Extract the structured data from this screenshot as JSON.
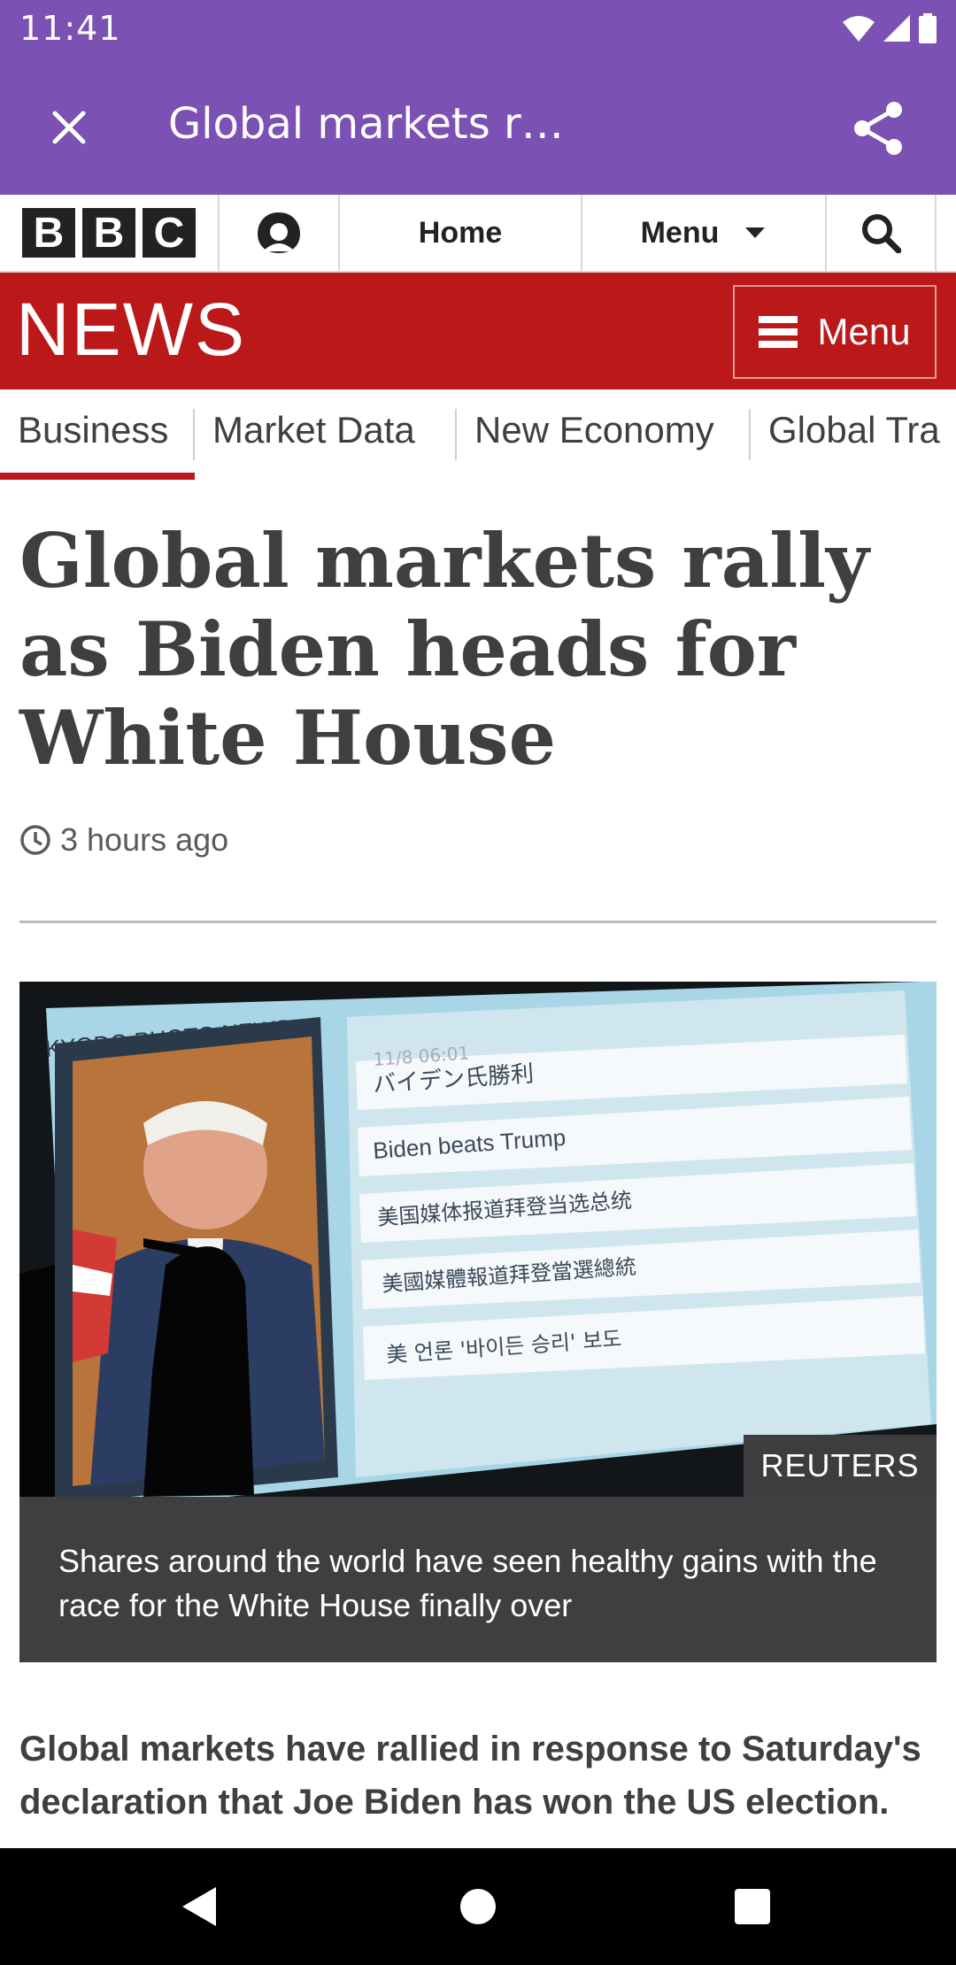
{
  "status_bar": {
    "time": "11:41",
    "icons": [
      "wifi-icon",
      "signal-icon",
      "battery-icon"
    ]
  },
  "app_bar": {
    "title": "Global markets r…",
    "close_icon": "close-icon",
    "share_icon": "share-icon"
  },
  "bbc_nav": {
    "logo_letters": [
      "B",
      "B",
      "C"
    ],
    "account_icon": "account-icon",
    "home_label": "Home",
    "menu_label": "Menu",
    "search_icon": "search-icon"
  },
  "news_banner": {
    "logo": "NEWS",
    "menu_label": "Menu"
  },
  "section_nav": {
    "items": [
      "Business",
      "Market Data",
      "New Economy",
      "Global Tra"
    ],
    "active": "Business"
  },
  "article": {
    "headline": "Global markets rally as Biden heads for White House",
    "timestamp": "3 hours ago",
    "image": {
      "screen_header": "KYODO PHOTO NEWS",
      "screen_time": "11/8 06:01",
      "screen_lines": [
        "バイデン氏勝利",
        "Biden beats Trump",
        "美国媒体报道拜登当选总统",
        "美國媒體報道拜登當選總統",
        "美 언론 '바이든 승리' 보도"
      ],
      "credit": "REUTERS"
    },
    "caption": "Shares around the world have seen healthy gains with the race for the White House finally over",
    "intro": "Global markets have rallied in response to Saturday's declaration that Joe Biden has won the US election."
  },
  "system_nav": {
    "buttons": [
      "back-icon",
      "home-icon",
      "recents-icon"
    ]
  },
  "colors": {
    "app_bar": "#7b51b3",
    "news_red": "#bb1919",
    "caption_bg": "#3f3f42",
    "text_dark": "#3f3f42"
  }
}
